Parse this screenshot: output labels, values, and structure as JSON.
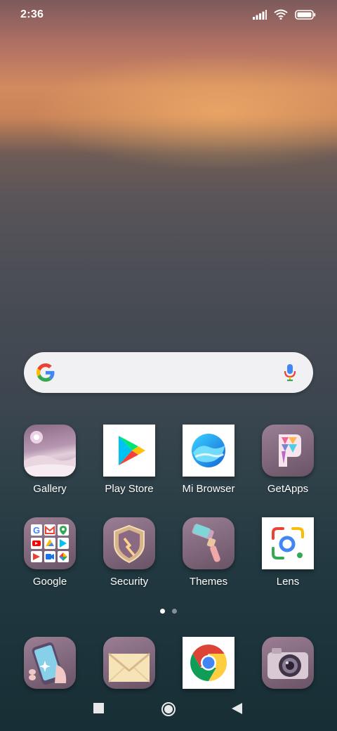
{
  "status_bar": {
    "time": "2:36",
    "icons": [
      "signal-icon",
      "wifi-icon",
      "battery-icon"
    ]
  },
  "search": {
    "logo": "google-g-icon",
    "mic": "microphone-icon"
  },
  "apps": [
    {
      "label": "Gallery",
      "icon": "gallery-icon"
    },
    {
      "label": "Play Store",
      "icon": "play-store-icon"
    },
    {
      "label": "Mi Browser",
      "icon": "mi-browser-icon"
    },
    {
      "label": "GetApps",
      "icon": "getapps-icon"
    },
    {
      "label": "Google",
      "icon": "google-folder-icon"
    },
    {
      "label": "Security",
      "icon": "security-icon"
    },
    {
      "label": "Themes",
      "icon": "themes-icon"
    },
    {
      "label": "Lens",
      "icon": "lens-icon"
    }
  ],
  "page_indicator": {
    "pages": 2,
    "current": 1
  },
  "dock": [
    {
      "icon": "phone-icon"
    },
    {
      "icon": "messaging-icon"
    },
    {
      "icon": "chrome-icon"
    },
    {
      "icon": "camera-icon"
    }
  ],
  "nav": [
    "recents-button",
    "home-button",
    "back-button"
  ],
  "colors": {
    "search_bg": "#f1f1f3",
    "google_blue": "#4285F4",
    "google_red": "#EA4335",
    "google_yellow": "#FBBC05",
    "google_green": "#34A853",
    "tile_purple": "#7d6478"
  }
}
